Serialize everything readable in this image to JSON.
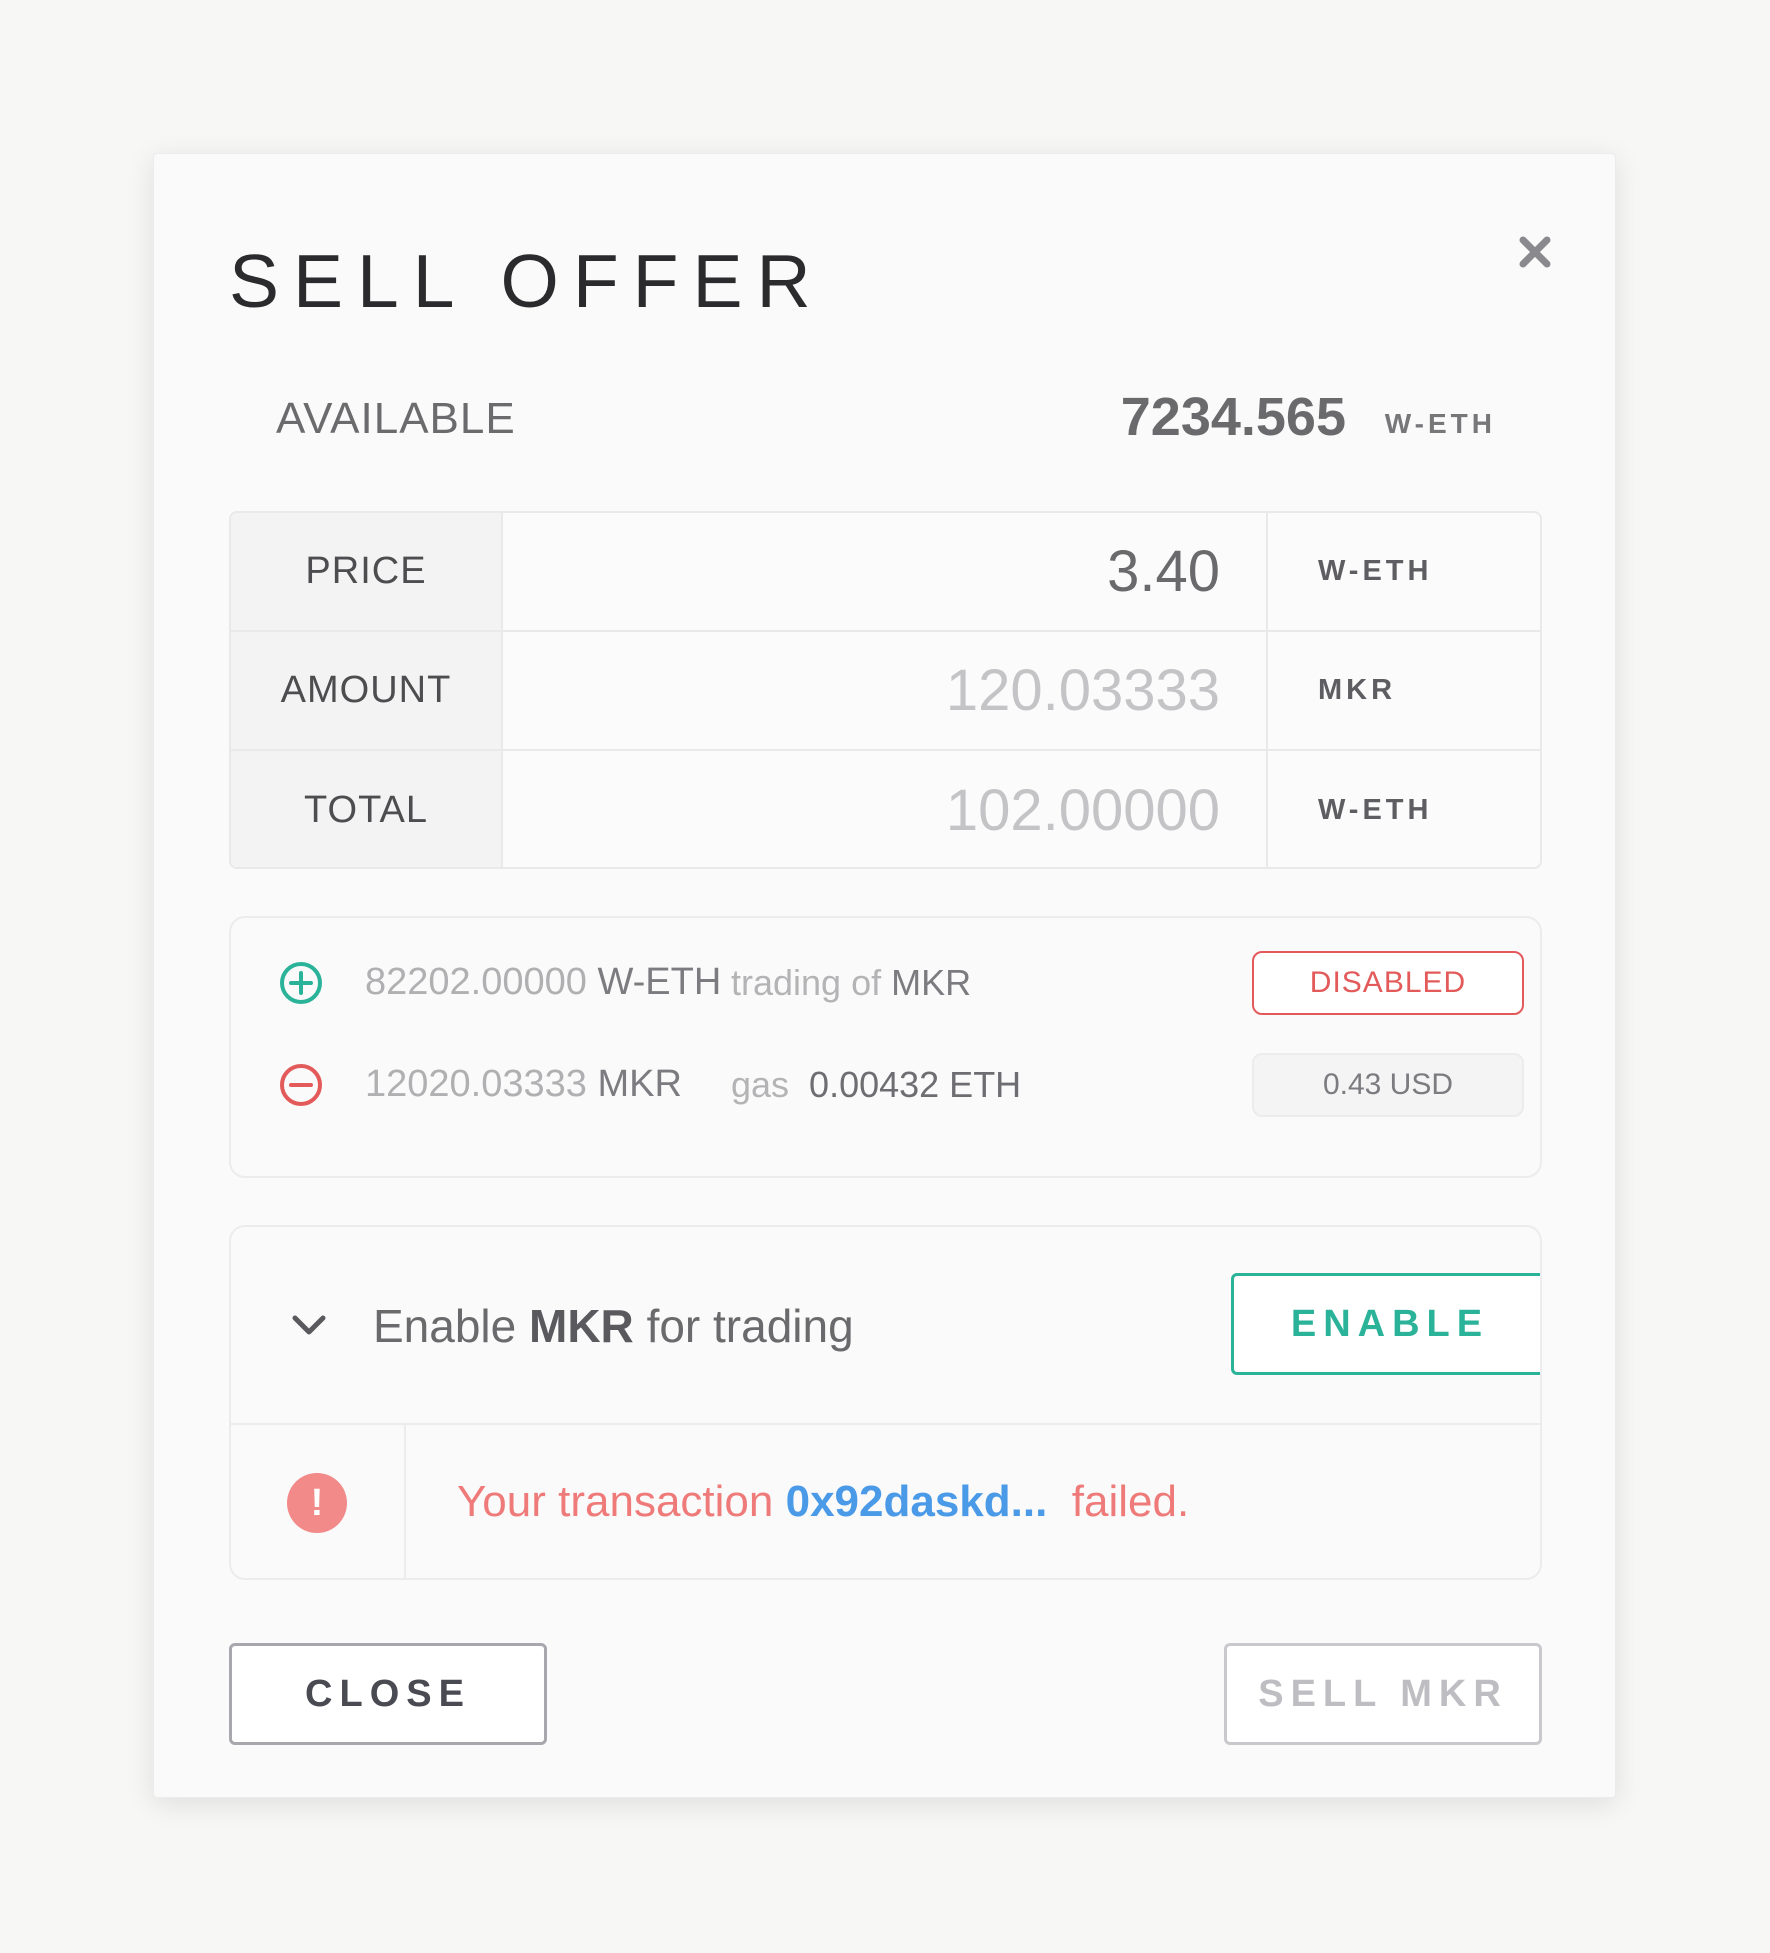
{
  "title": "SELL OFFER",
  "available": {
    "label": "AVAILABLE",
    "value": "7234.565",
    "unit": "W-ETH"
  },
  "form": {
    "rows": [
      {
        "label": "PRICE",
        "value": "3.40",
        "unit": "W-ETH"
      },
      {
        "label": "AMOUNT",
        "value": "120.03333",
        "unit": "MKR"
      },
      {
        "label": "TOTAL",
        "value": "102.00000",
        "unit": "W-ETH"
      }
    ]
  },
  "summary": {
    "plus_amount": "82202.00000",
    "plus_unit": "W-ETH",
    "trading_prefix": "trading of",
    "trading_token": "MKR",
    "trading_status": "DISABLED",
    "minus_amount": "12020.03333",
    "minus_unit": "MKR",
    "gas_label": "gas",
    "gas_value": "0.00432 ETH",
    "gas_usd": "0.43 USD"
  },
  "enable": {
    "prefix": "Enable",
    "token": "MKR",
    "suffix": "for trading",
    "button_label": "ENABLE"
  },
  "alert": {
    "icon_text": "!",
    "prefix": "Your transaction",
    "tx_hash": "0x92daskd...",
    "suffix": "failed."
  },
  "footer": {
    "close_label": "CLOSE",
    "sell_label": "SELL MKR"
  },
  "colors": {
    "accent_green": "#2bb39a",
    "danger_red": "#e35a5a",
    "link_blue": "#4a9ae8"
  },
  "icons": {
    "close": "close-icon",
    "plus": "plus-circle-icon",
    "minus": "minus-circle-icon",
    "chevron": "chevron-down-icon",
    "alert": "alert-icon"
  }
}
